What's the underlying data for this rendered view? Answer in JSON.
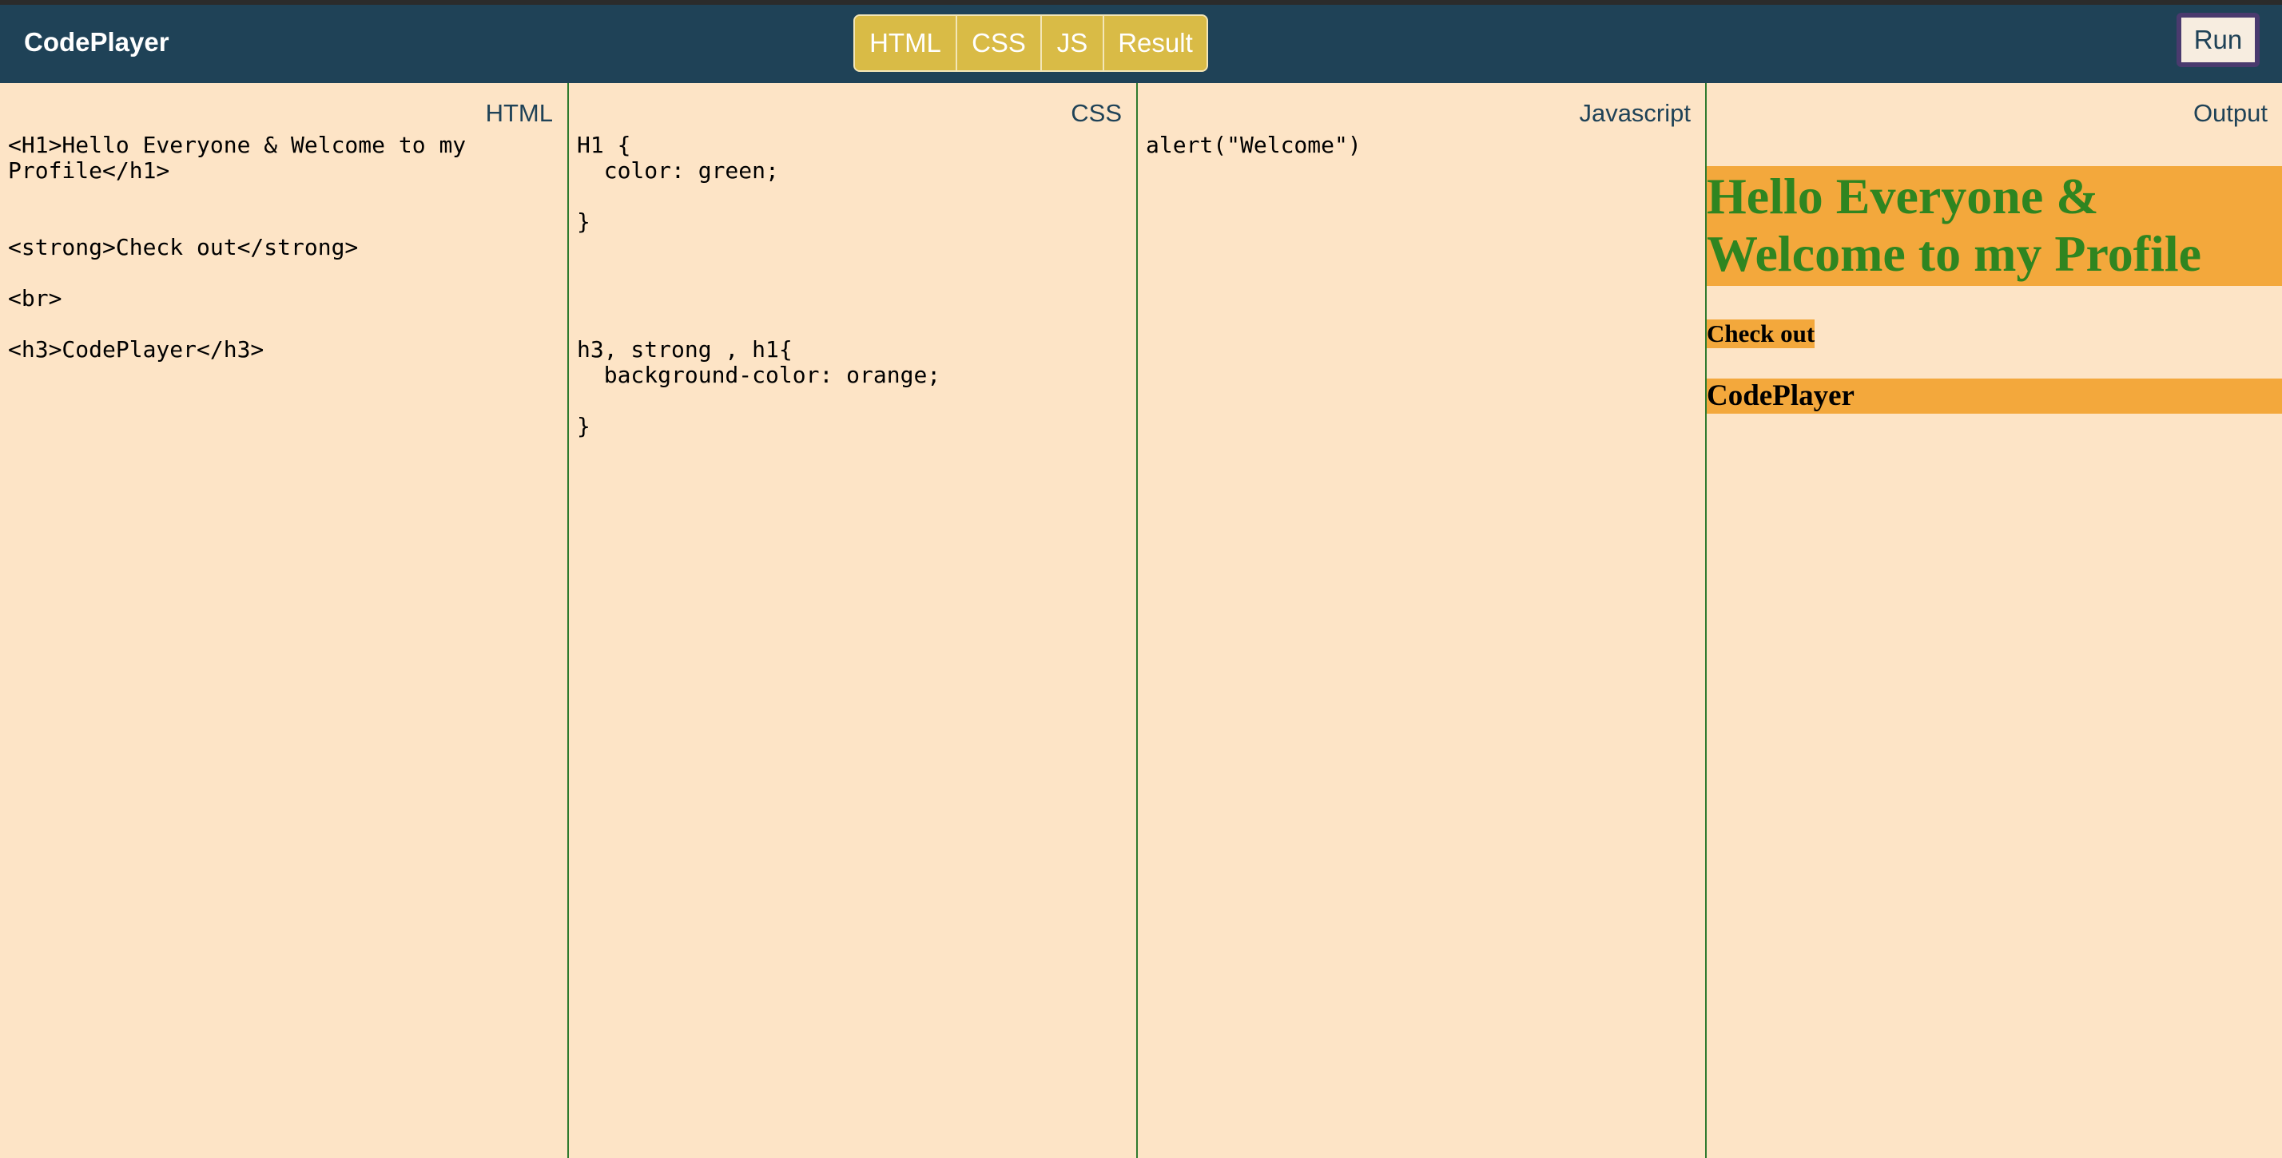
{
  "app": {
    "title": "CodePlayer"
  },
  "toggles": [
    {
      "label": "HTML"
    },
    {
      "label": "CSS"
    },
    {
      "label": "JS"
    },
    {
      "label": "Result"
    }
  ],
  "run_button": {
    "label": "Run"
  },
  "panels": {
    "html": {
      "label": "HTML",
      "code": "<H1>Hello Everyone & Welcome to my Profile</h1>\n\n\n<strong>Check out</strong>\n\n<br>\n\n<h3>CodePlayer</h3>"
    },
    "css": {
      "label": "CSS",
      "code": "H1 {\n  color: green;\n\n}\n\n\n\n\nh3, strong , h1{\n  background-color: orange;\n\n}"
    },
    "js": {
      "label": "Javascript",
      "code": "alert(\"Welcome\")"
    },
    "output": {
      "label": "Output",
      "h1": "Hello Everyone & Welcome to my Profile",
      "strong": "Check out",
      "h3": "CodePlayer"
    }
  },
  "colors": {
    "topbar": "#1f4257",
    "toggle_bg": "#d9bb46",
    "panel_bg": "#fde4c6",
    "panel_divider": "#2f7a2f",
    "output_highlight": "#f3a83c",
    "output_h1_text": "#2f8520"
  }
}
